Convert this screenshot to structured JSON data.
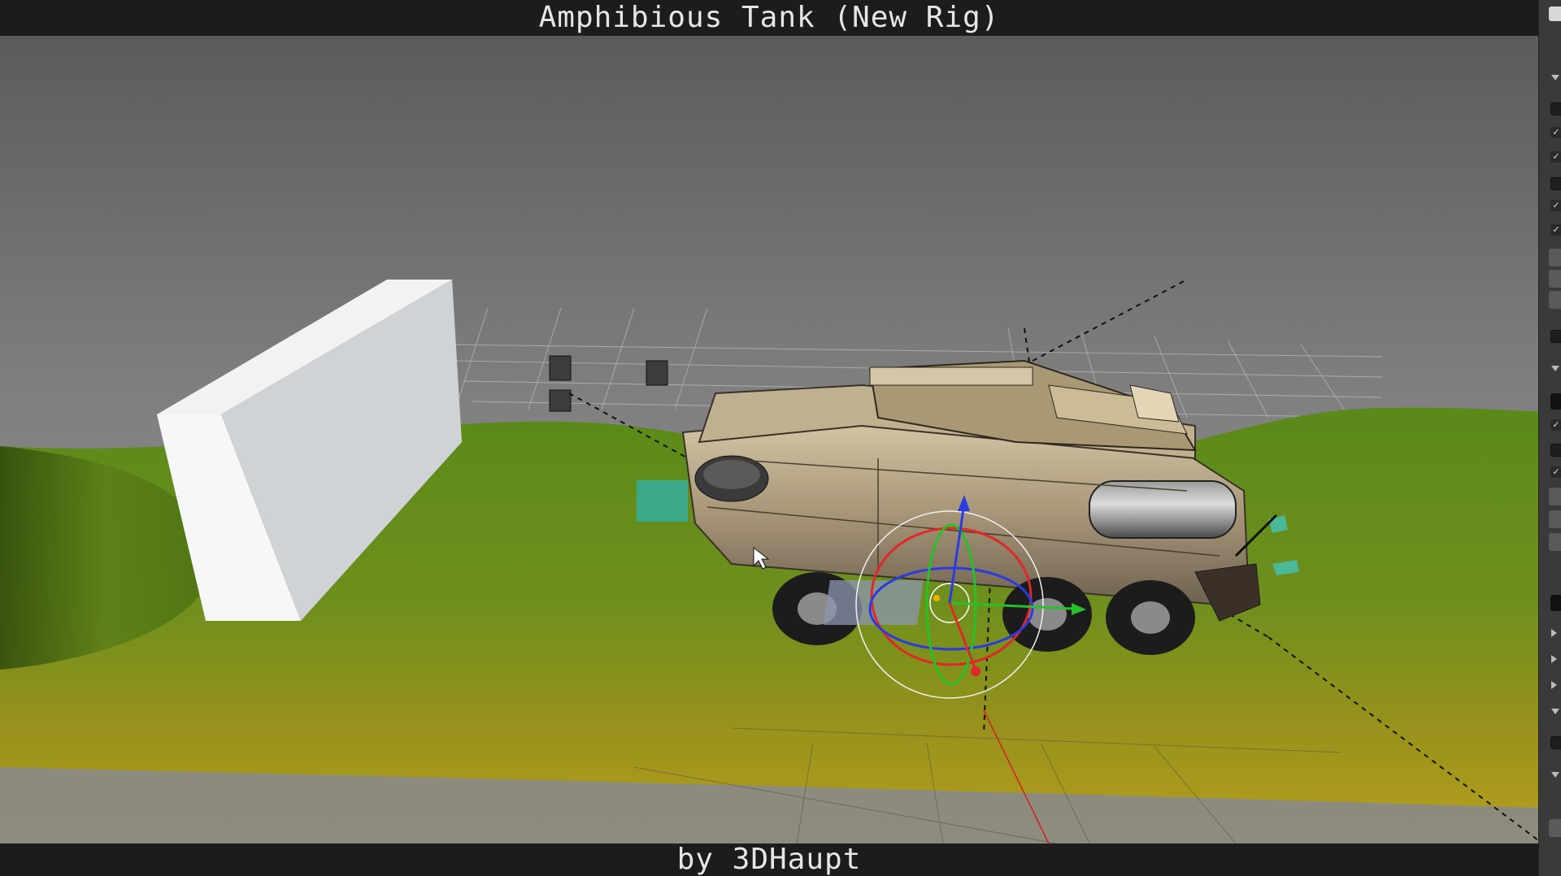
{
  "header": {
    "title": "Amphibious Tank (New Rig)"
  },
  "footer": {
    "credit": "by 3DHaupt"
  },
  "viewport": {
    "scene_objects": [
      "wall-block",
      "tank-body",
      "terrain",
      "floor-grid",
      "transform-gizmo",
      "control-empties"
    ],
    "colors": {
      "sky": "#7a7a7a",
      "terrain_green": "#6b8f1e",
      "terrain_yellow": "#b49a1c",
      "wall": "#ececec",
      "tank": "#b8a988",
      "gizmo_x": "#e03030",
      "gizmo_y": "#30c030",
      "gizmo_z": "#3040e0"
    }
  },
  "side_panel": {
    "collapsed": true,
    "icon": "properties-panel-icon"
  }
}
